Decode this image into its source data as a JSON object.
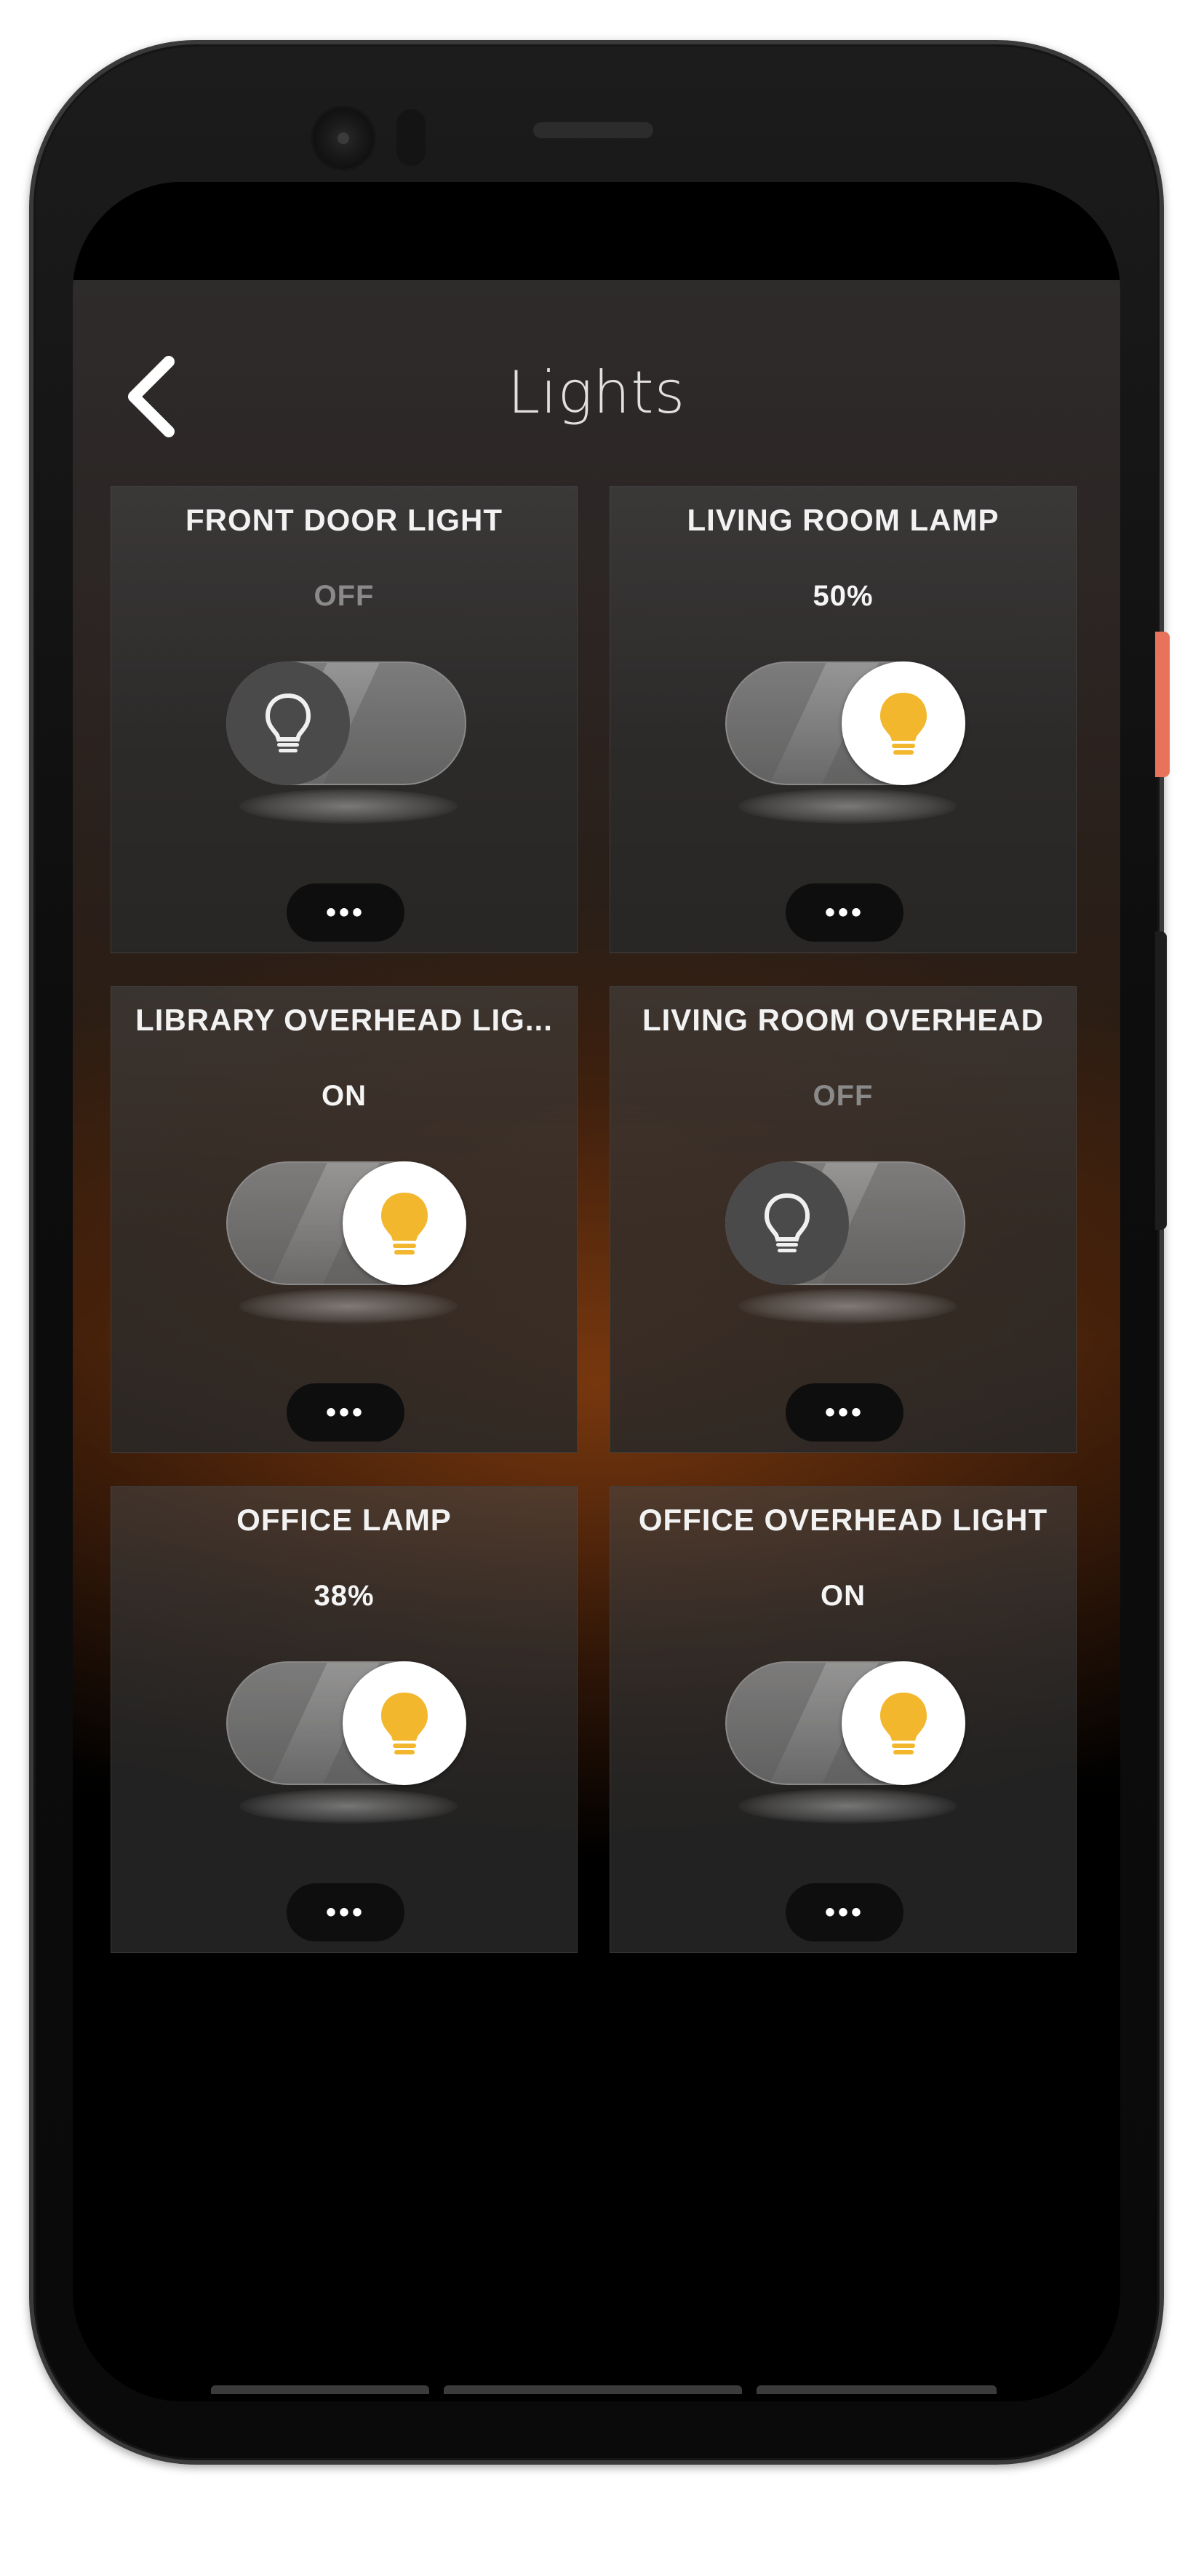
{
  "app": {
    "title": "Lights"
  },
  "colors": {
    "accent_on": "#f2b72c",
    "off_text": "#8a8a8a",
    "side_button": "#e8735a"
  },
  "lights": [
    {
      "name": "FRONT DOOR LIGHT",
      "status": "OFF",
      "state": "off",
      "more_label": "•••"
    },
    {
      "name": "LIVING ROOM LAMP",
      "status": "50%",
      "state": "on",
      "more_label": "•••"
    },
    {
      "name": "LIBRARY OVERHEAD LIG...",
      "status": "ON",
      "state": "on",
      "more_label": "•••"
    },
    {
      "name": "LIVING ROOM OVERHEAD",
      "status": "OFF",
      "state": "off",
      "more_label": "•••"
    },
    {
      "name": "OFFICE LAMP",
      "status": "38%",
      "state": "on",
      "more_label": "•••"
    },
    {
      "name": "OFFICE OVERHEAD LIGHT",
      "status": "ON",
      "state": "on",
      "more_label": "•••"
    }
  ],
  "icons": {
    "back": "chevron-left-icon",
    "bulb_on": "lightbulb-filled-icon",
    "bulb_off": "lightbulb-outline-icon",
    "more": "more-horizontal-icon"
  }
}
